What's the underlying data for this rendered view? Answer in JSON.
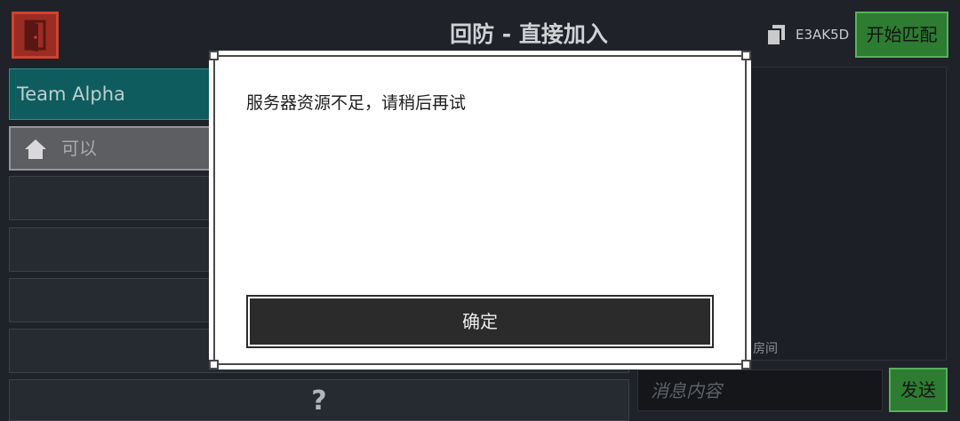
{
  "header": {
    "exit_icon": "door-exit-icon",
    "title": "回防 - 直接加入",
    "copy_icon": "copy-icon",
    "room_code": "E3AK5D",
    "start_match_label": "开始匹配"
  },
  "team_panel": {
    "team_name": "Team Alpha",
    "players": [
      {
        "icon": "house-icon",
        "name": "可以"
      }
    ],
    "footer_label": "?"
  },
  "chat": {
    "log_lines": [
      "房间"
    ],
    "input_placeholder": "消息内容",
    "send_label": "发送"
  },
  "dialog": {
    "message": "服务器资源不足，请稍后再试",
    "confirm_label": "确定"
  },
  "colors": {
    "background": "#1f2228",
    "team_accent": "#0f5c5e",
    "action_green": "#2e7b32",
    "exit_red": "#9b2c24",
    "dialog_bg": "#ffffff",
    "dialog_button": "#2b2b2b"
  }
}
